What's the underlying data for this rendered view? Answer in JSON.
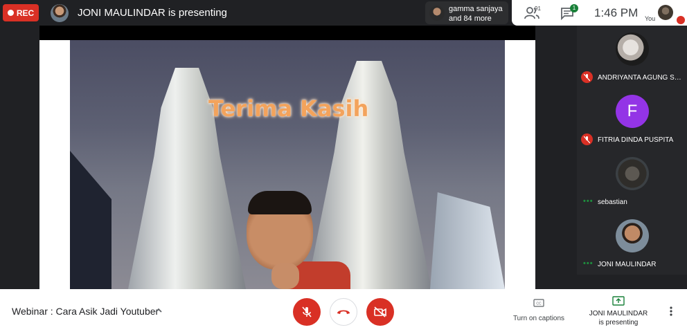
{
  "topbar": {
    "rec_label": "REC",
    "presenting_title": "JONI MAULINDAR is presenting",
    "people_chip": {
      "line1": "gamma sanjaya",
      "line2": "and 84 more"
    },
    "participant_count": "91",
    "chat_badge": "1",
    "time": "1:46 PM",
    "you_label": "You"
  },
  "slide": {
    "title": "Terima Kasih"
  },
  "participants": [
    {
      "name": "ANDRIYANTA AGUNG SAP...",
      "status": "muted"
    },
    {
      "name": "FITRIA DINDA PUSPITA",
      "status": "muted",
      "initial": "F",
      "avatar_color": "#9334e6"
    },
    {
      "name": "sebastian",
      "status": "speaking"
    },
    {
      "name": "JONI MAULINDAR",
      "status": "speaking"
    }
  ],
  "speaking_indicator": "•••",
  "bottombar": {
    "meeting_title": "Webinar : Cara Asik Jadi Youtuber",
    "captions_label": "Turn on captions",
    "presenting_line1": "JONI MAULINDAR",
    "presenting_line2": "is presenting"
  },
  "icons": {
    "topbar": [
      "record-dot",
      "people-icon",
      "chat-icon"
    ],
    "controls": [
      "mic-off-icon",
      "call-end-icon",
      "camera-off-icon",
      "closed-captions-icon",
      "present-screen-icon",
      "more-vert-icon"
    ]
  },
  "colors": {
    "accent_red": "#d93025",
    "accent_green": "#188038",
    "dark_bg": "#202124",
    "panel_bg": "#26272a"
  }
}
